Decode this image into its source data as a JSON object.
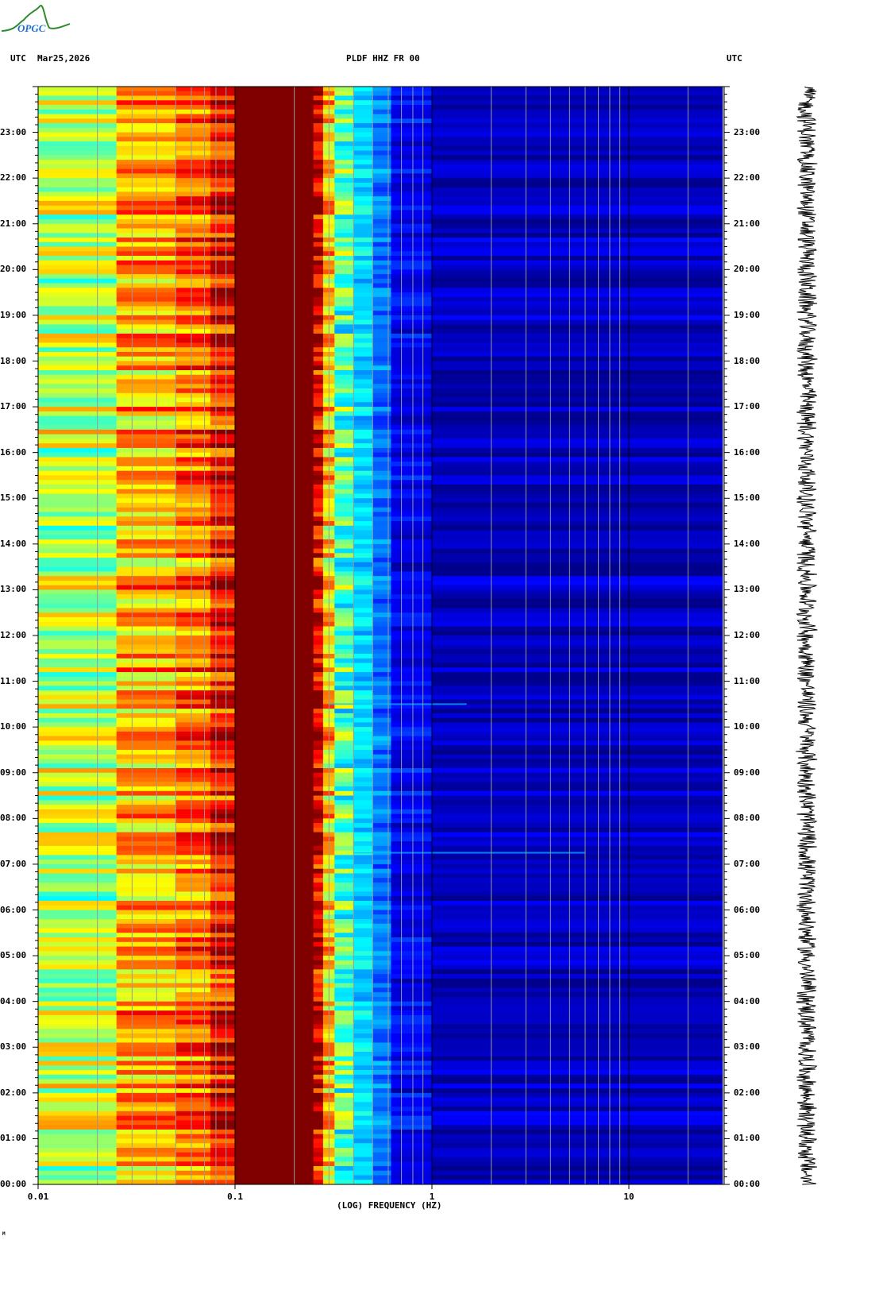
{
  "logo": {
    "text": "OPGC",
    "colors": {
      "curve": "#2e8b2e",
      "text": "#1e6fd0"
    }
  },
  "header": {
    "left_tz": "UTC",
    "date": "Mar25,2026",
    "station": "PLDF HHZ FR 00",
    "right_tz": "UTC"
  },
  "footer_mark": "M",
  "chart_data": {
    "type": "heatmap",
    "title": "PLDF HHZ FR 00",
    "xlabel": "(LOG) FREQUENCY (HZ)",
    "xscale": "log",
    "xlim": [
      0.01,
      30
    ],
    "x_tick_labels": [
      "0.01",
      "0.1",
      "1",
      "10"
    ],
    "x_tick_values": [
      0.01,
      0.1,
      1,
      10
    ],
    "ylabel": "UTC",
    "ylim_hours": [
      0,
      24
    ],
    "y_tick_labels": [
      "00:00",
      "01:00",
      "02:00",
      "03:00",
      "04:00",
      "05:00",
      "06:00",
      "07:00",
      "08:00",
      "09:00",
      "10:00",
      "11:00",
      "12:00",
      "13:00",
      "14:00",
      "15:00",
      "16:00",
      "17:00",
      "18:00",
      "19:00",
      "20:00",
      "21:00",
      "22:00",
      "23:00"
    ],
    "colormap": [
      "#00008b",
      "#0000ff",
      "#0080ff",
      "#00ffff",
      "#80ff80",
      "#ffff00",
      "#ff8000",
      "#ff0000",
      "#800000"
    ],
    "frequency_band_power": [
      {
        "f_lo": 0.01,
        "f_hi": 0.025,
        "level": 0.55
      },
      {
        "f_lo": 0.025,
        "f_hi": 0.05,
        "level": 0.7
      },
      {
        "f_lo": 0.05,
        "f_hi": 0.075,
        "level": 0.76
      },
      {
        "f_lo": 0.075,
        "f_hi": 0.1,
        "level": 0.86
      },
      {
        "f_lo": 0.1,
        "f_hi": 0.25,
        "level": 1.0
      },
      {
        "f_lo": 0.25,
        "f_hi": 0.28,
        "level": 0.9
      },
      {
        "f_lo": 0.28,
        "f_hi": 0.32,
        "level": 0.66
      },
      {
        "f_lo": 0.32,
        "f_hi": 0.4,
        "level": 0.45
      },
      {
        "f_lo": 0.4,
        "f_hi": 0.5,
        "level": 0.34
      },
      {
        "f_lo": 0.5,
        "f_hi": 0.62,
        "level": 0.24
      },
      {
        "f_lo": 0.62,
        "f_hi": 1.0,
        "level": 0.11
      },
      {
        "f_lo": 1.0,
        "f_hi": 30,
        "level": 0.05
      }
    ],
    "annotations": [
      {
        "time_hours": 10.5,
        "f_lo": 0.3,
        "f_hi": 1.5
      },
      {
        "time_hours": 7.25,
        "f_lo": 0.4,
        "f_hi": 6
      }
    ],
    "grid": true
  }
}
